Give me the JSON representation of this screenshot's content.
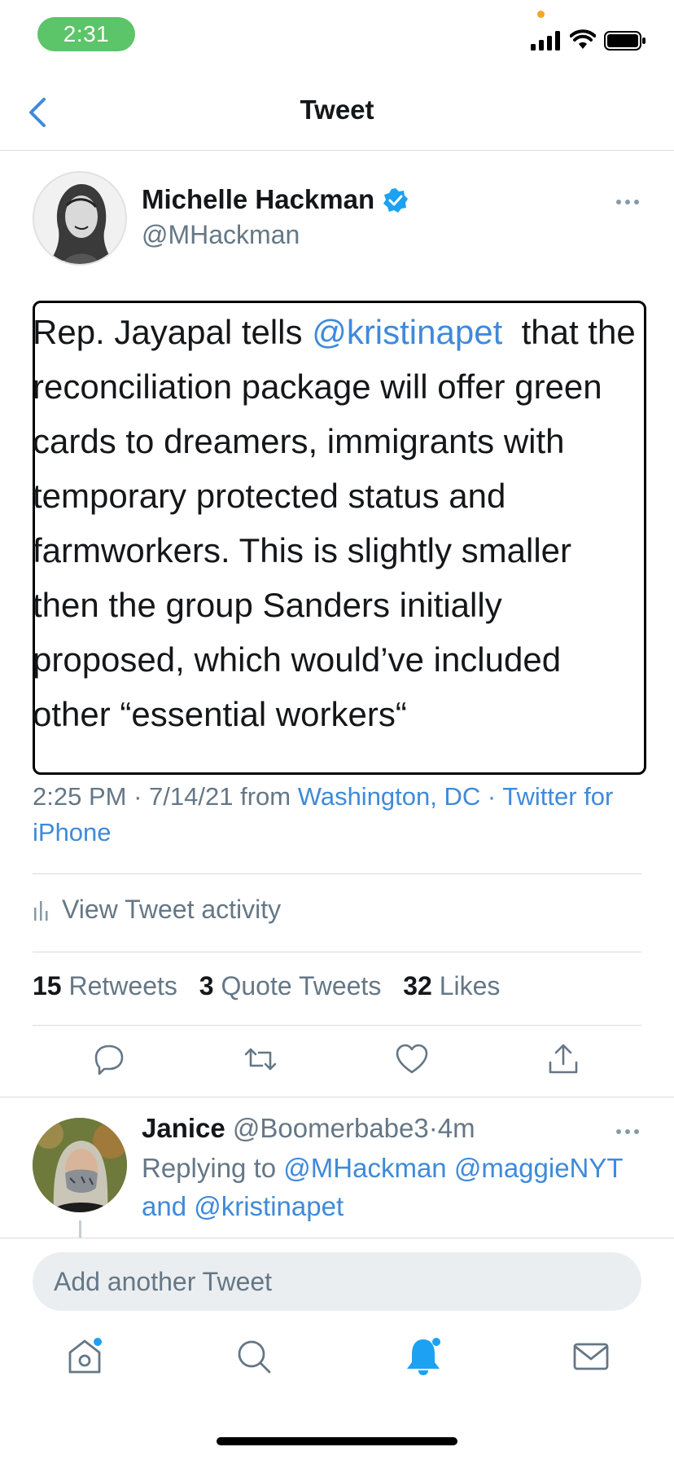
{
  "status_bar": {
    "time": "2:31"
  },
  "nav": {
    "title": "Tweet"
  },
  "tweet": {
    "author_name": "Michelle Hackman",
    "handle": "@MHackman",
    "text_parts": [
      "Rep. Jayapal tells ",
      "@kristinapet",
      "  that the reconciliation package will offer green cards to dreamers, immigrants with temporary protected status and farmworkers. This is slightly smaller then the group Sanders initially proposed, which would’ve included other “essential workers“"
    ],
    "time": "2:25 PM",
    "date": "7/14/21",
    "from_word": "from",
    "location": "Washington, DC",
    "source": "Twitter for iPhone",
    "activity_label": "View Tweet activity",
    "stats": {
      "retweets_count": "15",
      "retweets_label": "Retweets",
      "quotes_count": "3",
      "quotes_label": "Quote Tweets",
      "likes_count": "32",
      "likes_label": "Likes"
    }
  },
  "reply": {
    "name": "Janice",
    "handle": "@Boomerbabe3",
    "age": "4m",
    "replying_prefix": "Replying to",
    "mention1": "@MHackman",
    "mention2": "@maggieNYT",
    "and_word": "and",
    "mention3": "@kristinapet"
  },
  "compose": {
    "placeholder": "Add another Tweet"
  },
  "colors": {
    "accent": "#3f8ad9",
    "muted": "#657786",
    "time_pill": "#5cc469",
    "verified": "#1da1f2"
  },
  "icons": {
    "tabs": [
      "home-icon",
      "search-icon",
      "notifications-icon",
      "messages-icon"
    ],
    "actions": [
      "reply-icon",
      "retweet-icon",
      "like-icon",
      "share-icon"
    ]
  }
}
